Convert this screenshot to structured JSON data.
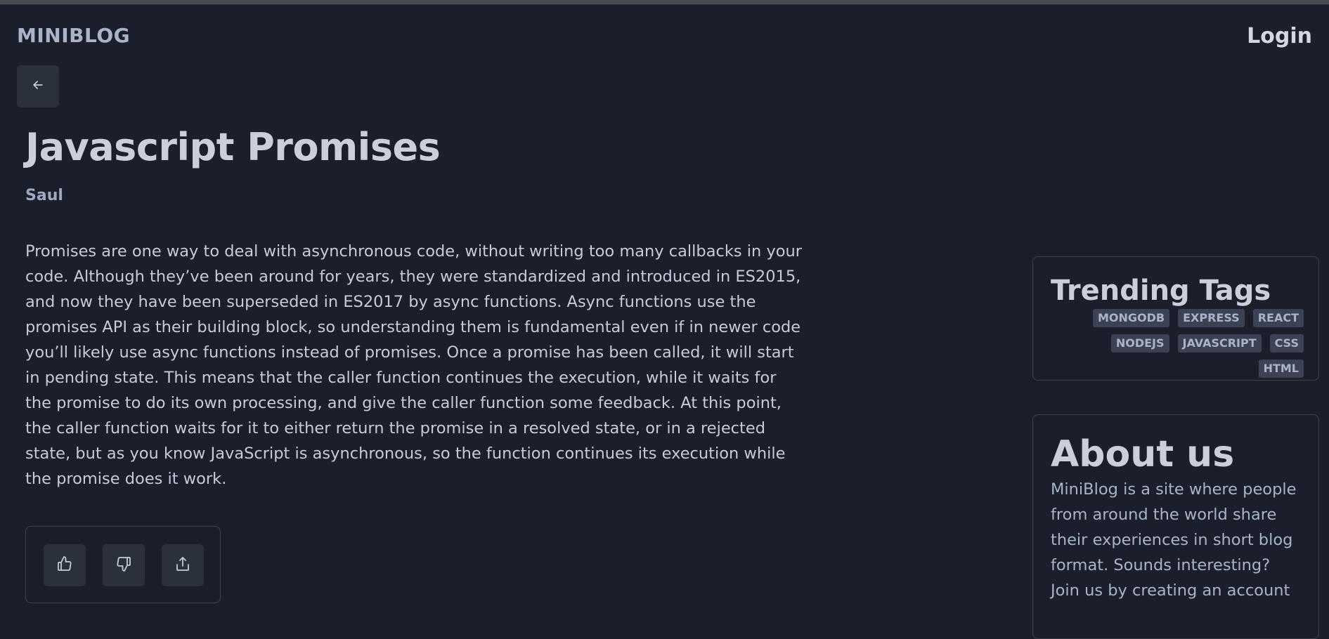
{
  "header": {
    "brand": "MINIBLOG",
    "login_label": "Login"
  },
  "post": {
    "title": "Javascript Promises",
    "author": "Saul",
    "body": "Promises are one way to deal with asynchronous code, without writing too many callbacks in your code. Although they’ve been around for years, they were standardized and introduced in ES2015, and now they have been superseded in ES2017 by async functions. Async functions use the promises API as their building block, so understanding them is fundamental even if in newer code you’ll likely use async functions instead of promises. Once a promise has been called, it will start in pending state. This means that the caller function continues the execution, while it waits for the promise to do its own processing, and give the caller function some feedback. At this point, the caller function waits for it to either return the promise in a resolved state, or in a rejected state, but as you know JavaScript is asynchronous, so the function continues its execution while the promise does it work."
  },
  "icons": {
    "back": "arrow-left-icon",
    "like": "thumbs-up-icon",
    "dislike": "thumbs-down-icon",
    "share": "share-icon"
  },
  "sidebar": {
    "trending": {
      "title": "Trending Tags",
      "tags": [
        "MONGODB",
        "EXPRESS",
        "REACT",
        "NODEJS",
        "JAVASCRIPT",
        "CSS",
        "HTML"
      ]
    },
    "about": {
      "title": "About us",
      "text": "MiniBlog is a site where people from around the world share their experiences in short blog format. Sounds interesting? Join us by creating an account"
    }
  },
  "colors": {
    "background": "#1b1f2b",
    "surface": "#2b303d",
    "border": "#3c4252",
    "text": "#c5cbd8"
  }
}
